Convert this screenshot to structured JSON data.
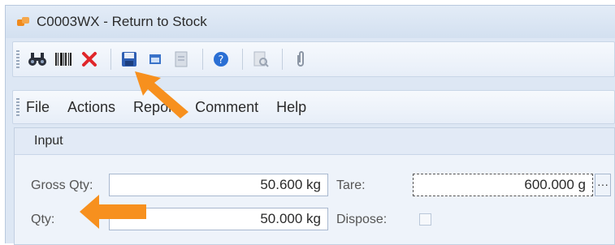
{
  "window": {
    "title": "C0003WX - Return to Stock"
  },
  "toolbar": {
    "buttons": [
      {
        "icon": "find-binoculars-icon"
      },
      {
        "icon": "barcode-icon"
      },
      {
        "icon": "delete-x-icon"
      },
      {
        "icon": "save-disk-icon"
      },
      {
        "icon": "window-icon"
      },
      {
        "icon": "document-icon"
      },
      {
        "icon": "help-icon"
      },
      {
        "icon": "print-preview-icon"
      },
      {
        "icon": "attachment-icon"
      }
    ]
  },
  "menu": {
    "items": [
      "File",
      "Actions",
      "Report",
      "Comment",
      "Help"
    ]
  },
  "input_group": {
    "title": "Input",
    "gross_qty": {
      "label": "Gross Qty:",
      "value": "50.600 kg"
    },
    "tare": {
      "label": "Tare:",
      "value": "600.000 g",
      "button": "···"
    },
    "qty": {
      "label": "Qty:",
      "value": "50.000 kg"
    },
    "dispose": {
      "label": "Dispose:",
      "checked": false
    }
  },
  "colors": {
    "accent_arrow": "#f7901e",
    "delete_red": "#e0262a",
    "help_blue": "#2a6fd4"
  }
}
